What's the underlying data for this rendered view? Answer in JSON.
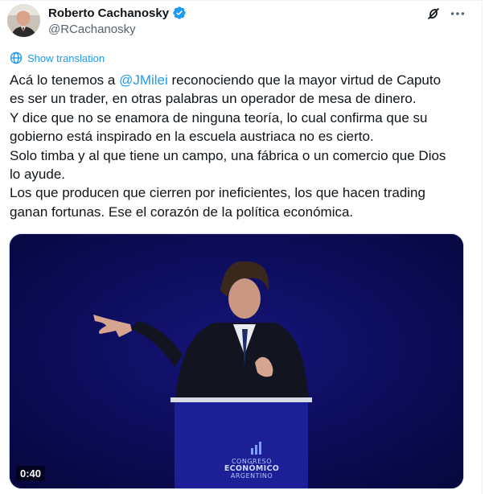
{
  "author": {
    "name": "Roberto Cachanosky",
    "handle": "@RCachanosky",
    "verified": true
  },
  "actions": {
    "grok_icon": "grok-icon",
    "more_icon": "more-icon"
  },
  "translation": {
    "label": "Show translation"
  },
  "tweet": {
    "line1_before": "Acá lo tenemos a ",
    "mention": "@JMilei",
    "line1_after": " reconociendo que la mayor virtud de Caputo",
    "line2": "es ser un trader, en otras palabras un operador de mesa de dinero.",
    "line3": "Y dice que no se enamora de ninguna teoría, lo cual confirma que su",
    "line4": "gobierno está inspirado en la escuela austriaca no es cierto.",
    "line5": "Solo timba y al que tiene un campo, una fábrica o un comercio que Dios",
    "line6": "lo ayude.",
    "line7": "Los que producen que cierren por ineficientes, los que hacen trading",
    "line8": "ganan fortunas. Ese el corazón de la política económica."
  },
  "video": {
    "duration": "0:40",
    "podium_line1": "CONGRESO",
    "podium_line2": "ECONÓMICO",
    "podium_line3": "ARGENTINO"
  },
  "colors": {
    "accent": "#1d9bf0",
    "text": "#0f1419",
    "secondary": "#536471",
    "video_bg": "#0a0a52"
  }
}
